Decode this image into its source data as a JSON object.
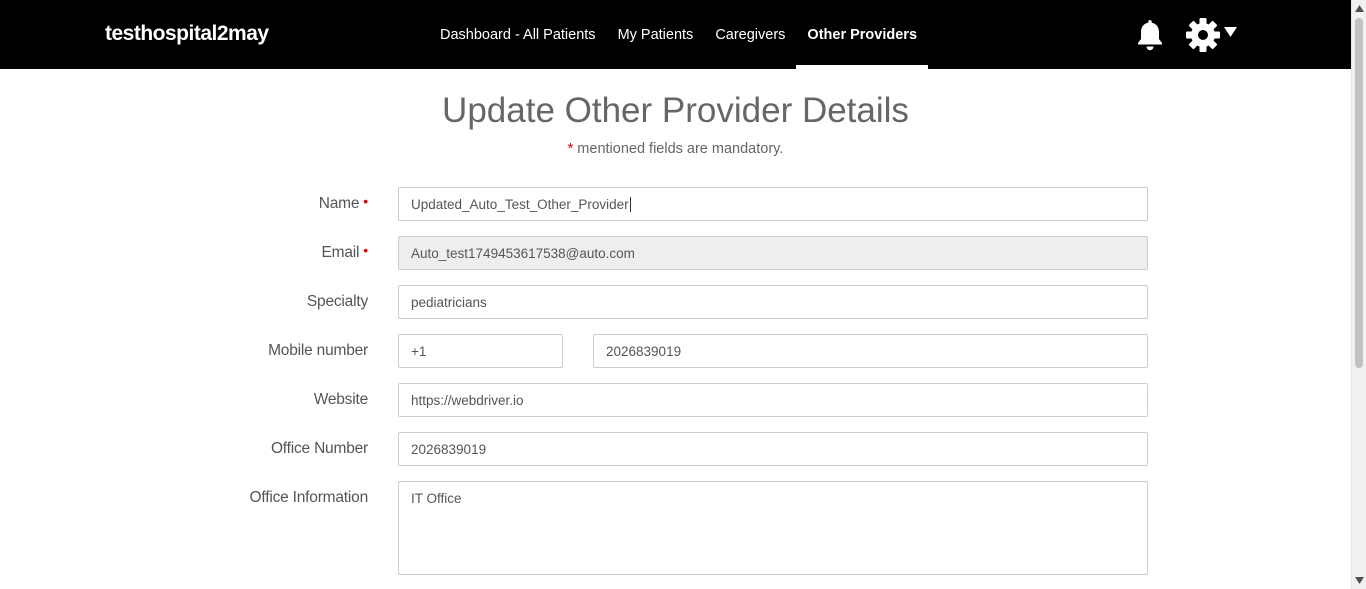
{
  "navbar": {
    "brand": "testhospital2may",
    "items": [
      {
        "label": "Dashboard - All Patients",
        "active": false
      },
      {
        "label": "My Patients",
        "active": false
      },
      {
        "label": "Caregivers",
        "active": false
      },
      {
        "label": "Other Providers",
        "active": true
      }
    ],
    "icons": [
      "bell-icon",
      "gear-icon",
      "caret-down-icon"
    ]
  },
  "page": {
    "title": "Update Other Provider Details",
    "mandatory_star": "*",
    "mandatory_note": "mentioned fields are mandatory."
  },
  "form": {
    "name": {
      "label": "Name",
      "required": true,
      "value": "Updated_Auto_Test_Other_Provider"
    },
    "email": {
      "label": "Email",
      "required": true,
      "value": "Auto_test1749453617538@auto.com",
      "disabled": true
    },
    "specialty": {
      "label": "Specialty",
      "value": "pediatricians"
    },
    "mobile": {
      "label": "Mobile number",
      "country_code": "+1",
      "number": "2026839019"
    },
    "website": {
      "label": "Website",
      "value": "https://webdriver.io"
    },
    "office_number": {
      "label": "Office Number",
      "value": "2026839019"
    },
    "office_info": {
      "label": "Office Information",
      "value": "IT Office"
    },
    "required_marker": "•"
  },
  "colors": {
    "navbar_bg": "#000000",
    "title_text": "#666666",
    "required_red": "#e00000",
    "disabled_bg": "#eeeeee"
  }
}
